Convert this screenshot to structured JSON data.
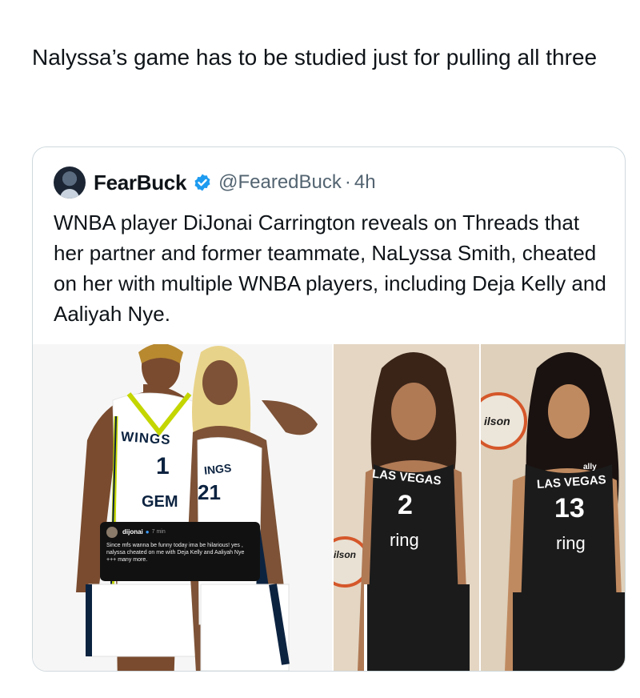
{
  "post": {
    "caption": "Nalyssa’s game has to be studied just for pulling all three"
  },
  "quoted": {
    "display_name": "FearBuck",
    "handle": "@FearedBuck",
    "separator": "·",
    "time": "4h",
    "text": "WNBA player DiJonai Carrington reveals on Threads that her partner and former teammate, NaLyssa Smith, cheated on her with multiple WNBA players, including Deja Kelly and Aaliyah Nye."
  },
  "media": {
    "left_photo": {
      "jersey_1_team": "WINGS",
      "jersey_1_number": "1",
      "jersey_1_sponsor": "GEM",
      "jersey_2_team": "INGS",
      "jersey_2_number": "21"
    },
    "threads_overlay": {
      "username": "dijonai",
      "time": "7 min",
      "text": "Since mfs wanna be funny today ima be hilarious! yes , nalyssa cheated on me with Deja Kelly and Aaliyah Nye +++ many more."
    },
    "middle_photo": {
      "team": "LAS VEGAS",
      "number": "2",
      "sponsor": "ring",
      "ball_brand": "ilson"
    },
    "right_photo": {
      "team": "LAS VEGAS",
      "number": "13",
      "sponsor": "ring",
      "ball_brand": "ilson",
      "top_sponsor": "ally"
    }
  },
  "colors": {
    "text": "#0f1419",
    "secondary": "#536471",
    "border": "#cfd9de",
    "verified": "#1d9bf0",
    "wings_navy": "#0c2340",
    "wings_lime": "#c4d600",
    "aces_black": "#1b1b1b"
  }
}
